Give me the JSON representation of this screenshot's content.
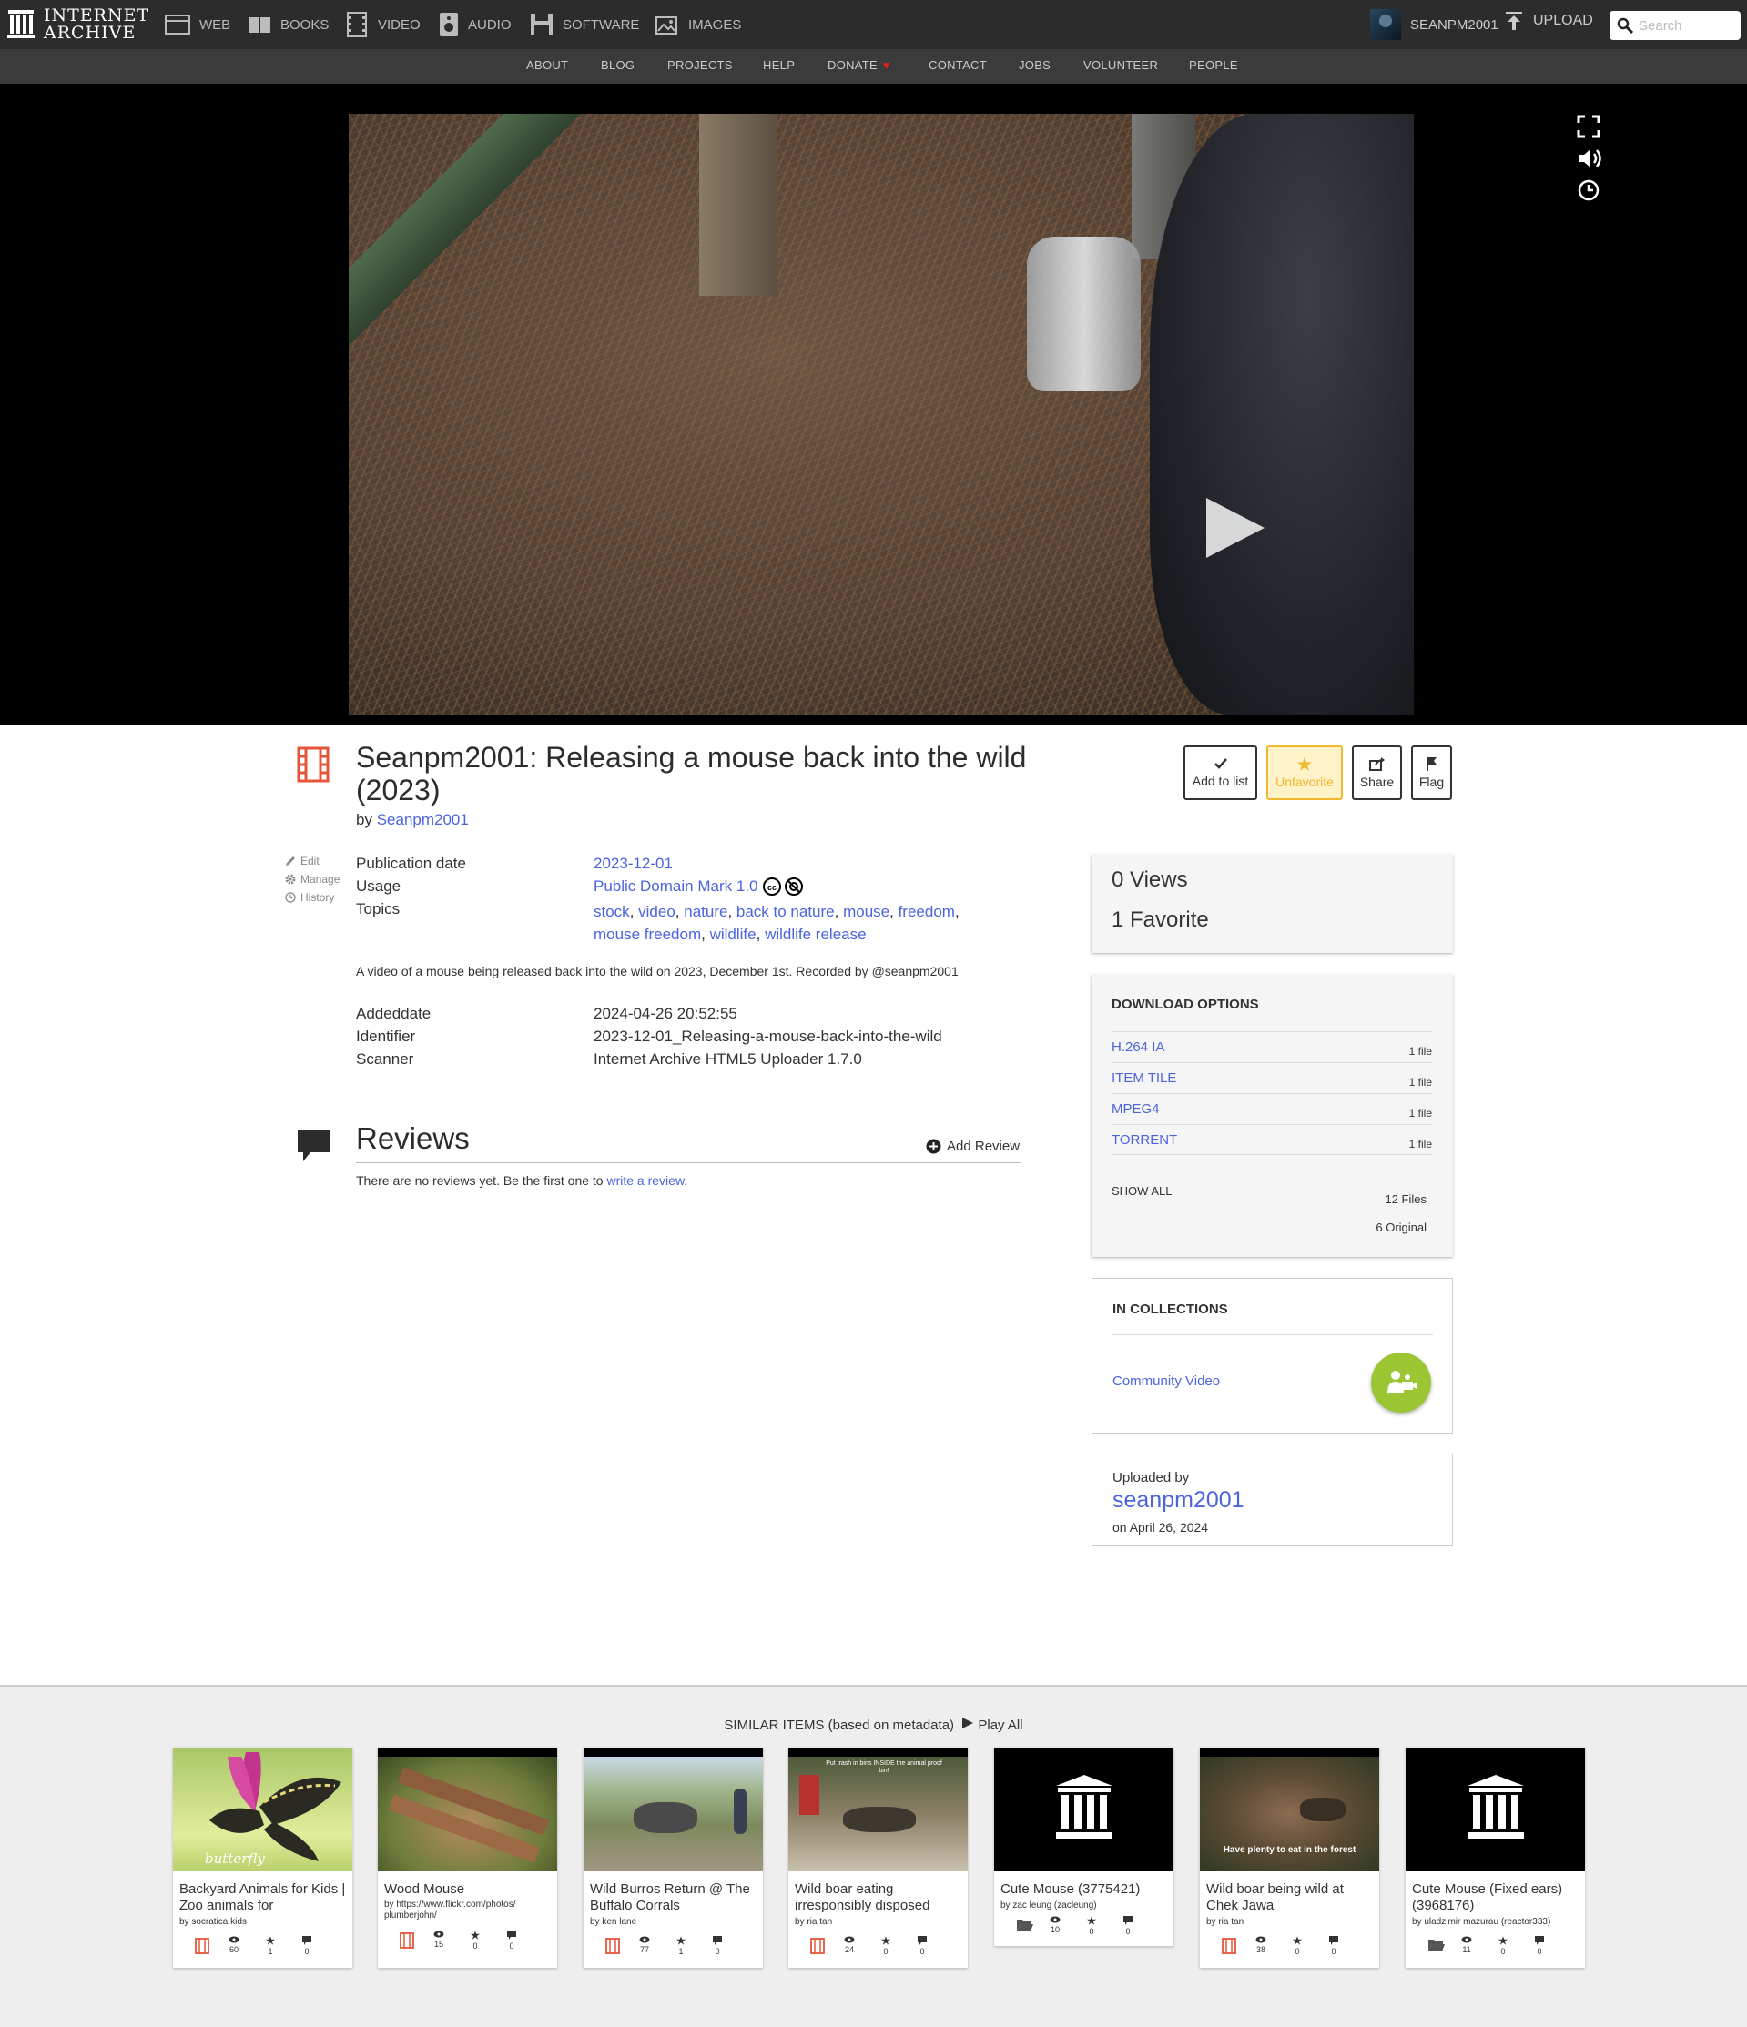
{
  "nav": {
    "logo_line1": "INTERNET",
    "logo_line2": "ARCHIVE",
    "media": [
      {
        "label": "WEB",
        "icon": "web-icon"
      },
      {
        "label": "BOOKS",
        "icon": "books-icon"
      },
      {
        "label": "VIDEO",
        "icon": "video-icon"
      },
      {
        "label": "AUDIO",
        "icon": "audio-icon"
      },
      {
        "label": "SOFTWARE",
        "icon": "software-icon"
      },
      {
        "label": "IMAGES",
        "icon": "images-icon"
      }
    ],
    "username": "SEANPM2001",
    "upload_label": "UPLOAD",
    "search_placeholder": "Search"
  },
  "subnav": [
    "ABOUT",
    "BLOG",
    "PROJECTS",
    "HELP",
    "DONATE",
    "CONTACT",
    "JOBS",
    "VOLUNTEER",
    "PEOPLE"
  ],
  "item": {
    "title": "Seanpm2001: Releasing a mouse back into the wild (2023)",
    "by_prefix": "by",
    "creator": "Seanpm2001",
    "actions": {
      "add_to_list": "Add to list",
      "favorite": "Unfavorite",
      "share": "Share",
      "flag": "Flag"
    },
    "side_links": {
      "edit": "Edit",
      "manage": "Manage",
      "history": "History"
    },
    "metadata": {
      "publication_date_label": "Publication date",
      "publication_date": "2023-12-01",
      "usage_label": "Usage",
      "usage": "Public Domain Mark 1.0",
      "topics_label": "Topics",
      "topics": [
        "stock",
        "video",
        "nature",
        "back to nature",
        "mouse",
        "freedom",
        "mouse freedom",
        "wildlife",
        "wildlife release"
      ]
    },
    "description": "A video of a mouse being released back into the wild on 2023, December 1st. Recorded by @seanpm2001",
    "extra": {
      "addeddate_label": "Addeddate",
      "addeddate": "2024-04-26 20:52:55",
      "identifier_label": "Identifier",
      "identifier": "2023-12-01_Releasing-a-mouse-back-into-the-wild",
      "scanner_label": "Scanner",
      "scanner": "Internet Archive HTML5 Uploader 1.7.0"
    }
  },
  "reviews": {
    "title": "Reviews",
    "add_label": "Add Review",
    "empty_text": "There are no reviews yet. Be the first one to",
    "write_link": "write a review",
    "period": "."
  },
  "stats": {
    "views": "0 Views",
    "favorites": "1 Favorite"
  },
  "downloads": {
    "title": "DOWNLOAD OPTIONS",
    "rows": [
      {
        "format": "H.264 IA",
        "count": "1 file"
      },
      {
        "format": "ITEM TILE",
        "count": "1 file"
      },
      {
        "format": "MPEG4",
        "count": "1 file"
      },
      {
        "format": "TORRENT",
        "count": "1 file"
      }
    ],
    "show_all": "SHOW ALL",
    "files_total": "12 Files",
    "original": "6 Original"
  },
  "collections": {
    "title": "IN COLLECTIONS",
    "name": "Community Video"
  },
  "uploader": {
    "label": "Uploaded by",
    "name": "seanpm2001",
    "date": "on April 26, 2024"
  },
  "similar": {
    "title": "SIMILAR ITEMS (based on metadata)",
    "play_all": "Play All",
    "items": [
      {
        "title": "Backyard Animals for Kids | Zoo animals for",
        "by": "by socratica kids",
        "views": "60",
        "favs": "1",
        "reviews": "0",
        "thumb_text": "butterfly"
      },
      {
        "title": "Wood Mouse",
        "by": "by https://www.flickr.com/photos/ plumberjohn/",
        "views": "15",
        "favs": "0",
        "reviews": "0",
        "thumb_text": ""
      },
      {
        "title": "Wild Burros Return @ The Buffalo Corrals",
        "by": "by ken lane",
        "views": "77",
        "favs": "1",
        "reviews": "0",
        "thumb_text": ""
      },
      {
        "title": "Wild boar eating irresponsibly disposed",
        "by": "by ria tan",
        "views": "24",
        "favs": "0",
        "reviews": "0",
        "thumb_text": "Put trash in bins INSIDE the animal proof bin!"
      },
      {
        "title": "Cute Mouse (3775421)",
        "by": "by zac leung (zacleung)",
        "views": "10",
        "favs": "0",
        "reviews": "0",
        "thumb_text": ""
      },
      {
        "title": "Wild boar being wild at Chek Jawa",
        "by": "by ria tan",
        "views": "38",
        "favs": "0",
        "reviews": "0",
        "thumb_text": "Have plenty to eat in the forest"
      },
      {
        "title": "Cute Mouse (Fixed ears) (3968176)",
        "by": "by uladzimir mazurau (reactor333)",
        "views": "11",
        "favs": "0",
        "reviews": "0",
        "thumb_text": ""
      }
    ]
  }
}
